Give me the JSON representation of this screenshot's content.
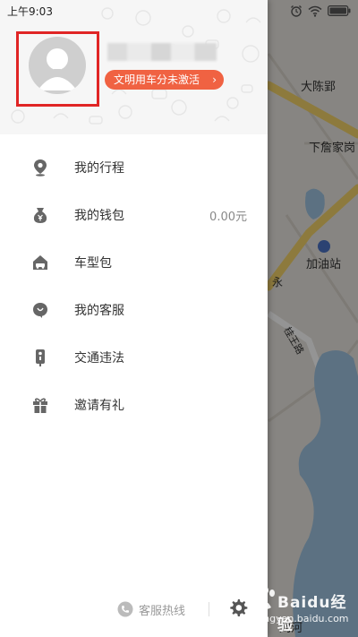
{
  "status_bar": {
    "time": "上午9:03",
    "icons": [
      "alarm-icon",
      "wifi-icon",
      "battery-icon"
    ]
  },
  "map": {
    "labels": {
      "dachenying": "大陈郢",
      "xiazhanjiagang": "下詹家岗",
      "gas_station": "加油站",
      "road_a": "永",
      "road_b": "桂王路",
      "bottom": "刘河"
    },
    "chat_icon": "chat-bubble-icon"
  },
  "drawer": {
    "user": {
      "avatar_icon": "user-avatar-icon",
      "civil_driving_badge": "文明用车分未激活",
      "badge_chevron": "›"
    },
    "menu": [
      {
        "key": "trips",
        "icon": "location-pin-icon",
        "label": "我的行程",
        "value": ""
      },
      {
        "key": "wallet",
        "icon": "money-bag-icon",
        "label": "我的钱包",
        "value": "0.00元"
      },
      {
        "key": "car_package",
        "icon": "car-package-icon",
        "label": "车型包",
        "value": ""
      },
      {
        "key": "service",
        "icon": "customer-service-icon",
        "label": "我的客服",
        "value": ""
      },
      {
        "key": "violations",
        "icon": "traffic-light-icon",
        "label": "交通违法",
        "value": ""
      },
      {
        "key": "invite",
        "icon": "gift-icon",
        "label": "邀请有礼",
        "value": ""
      }
    ],
    "footer": {
      "hotline_label": "客服热线",
      "hotline_icon": "phone-icon",
      "settings_icon": "gear-icon"
    }
  },
  "watermark": {
    "brand": "Baidu经验",
    "url": "jingyan.baidu.com"
  },
  "colors": {
    "accent_orange": "#f06242",
    "highlight_red": "#e02525",
    "icon_gray": "#666666",
    "map_bg": "#e9e6e0",
    "road_yellow": "#f3d36a",
    "water_blue": "#9fc3e0"
  }
}
